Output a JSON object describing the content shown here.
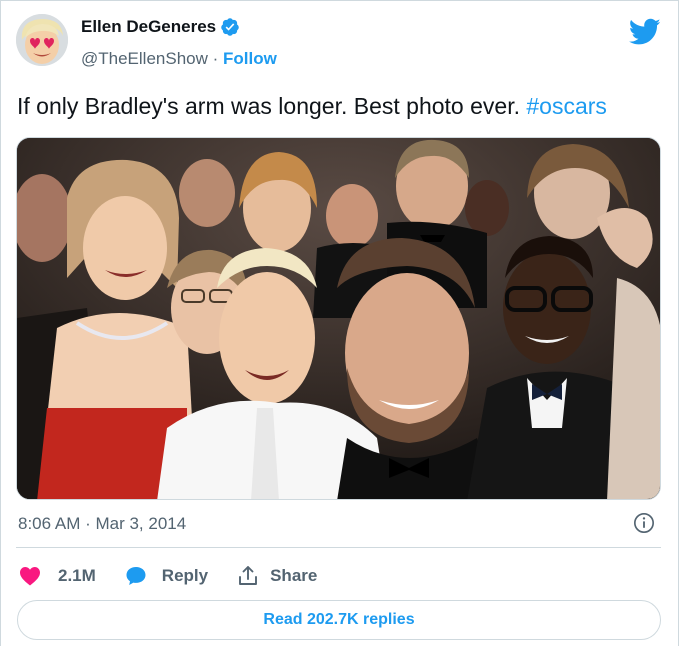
{
  "tweet": {
    "author": {
      "display_name": "Ellen DeGeneres",
      "handle": "@TheEllenShow",
      "separator": " · ",
      "follow_label": "Follow",
      "verified": true,
      "avatar_icon": "avatar-heart-eyes-emoji"
    },
    "text": "If only Bradley's arm was longer. Best photo ever. ",
    "hashtag": "#oscars",
    "timestamp": "8:06 AM · Mar 3, 2014",
    "likes": "2.1M",
    "reply_label": "Reply",
    "share_label": "Share",
    "read_replies_label": "Read 202.7K replies"
  },
  "colors": {
    "accent": "#1d9bf0",
    "like": "#f91880",
    "text": "#0f1419",
    "secondary_text": "#536471",
    "border": "#cfd9de"
  },
  "icons": {
    "brand": "twitter-bird-icon",
    "verified": "verified-badge-icon",
    "info": "info-icon",
    "like": "heart-icon",
    "reply": "speech-bubble-icon",
    "share": "share-upload-icon"
  }
}
